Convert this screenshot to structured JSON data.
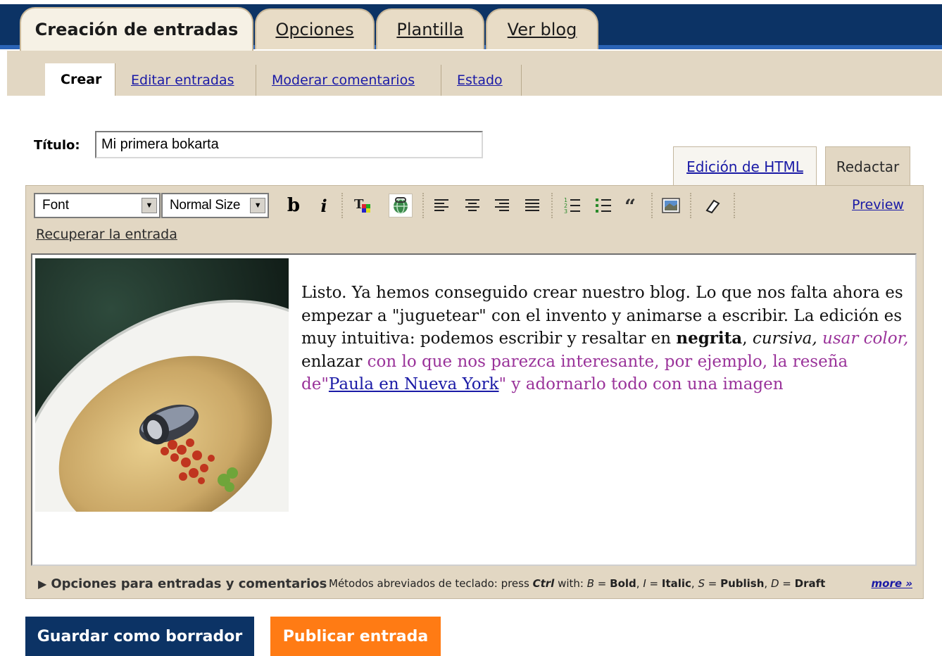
{
  "top_tabs": [
    {
      "label": "Creación de entradas",
      "active": true
    },
    {
      "label": "Opciones",
      "active": false
    },
    {
      "label": "Plantilla",
      "active": false
    },
    {
      "label": "Ver blog",
      "active": false
    }
  ],
  "sub_tabs": [
    {
      "label": "Crear",
      "active": true
    },
    {
      "label": "Editar entradas",
      "active": false
    },
    {
      "label": "Moderar comentarios",
      "active": false
    },
    {
      "label": "Estado",
      "active": false
    }
  ],
  "title_field": {
    "label": "Título:",
    "value": "Mi primera bokarta"
  },
  "mode_tabs": {
    "html": "Edición de HTML",
    "compose": "Redactar"
  },
  "toolbar": {
    "font_select": "Font",
    "size_select": "Normal Size",
    "bold": "b",
    "italic": "i",
    "preview": "Preview",
    "recover": "Recuperar la entrada",
    "icons": [
      "bold-icon",
      "italic-icon",
      "text-color-icon",
      "link-icon",
      "align-left-icon",
      "align-center-icon",
      "align-right-icon",
      "justify-icon",
      "numbered-list-icon",
      "bullet-list-icon",
      "blockquote-icon",
      "image-icon",
      "eraser-icon"
    ]
  },
  "post": {
    "p1": "Listo. Ya hemos conseguido crear nuestro blog. Lo que nos falta ahora es empezar a \"juguetear\" con el invento y animarse a escribir. La edición es muy intuitiva: podemos escribir y resaltar en ",
    "bold": "negrita",
    "comma": ",",
    "italic": "cursiva,",
    "colored": "usar color,",
    "plain2": "enlazar",
    "purple1": "con lo que nos parezca interesante, por ejemplo, la reseña de\"",
    "link": "Paula en Nueva York",
    "purple2": "\" y adornarlo todo con una imagen"
  },
  "footer": {
    "options": "Opciones para entradas y comentarios",
    "shortcuts_prefix": "Métodos abreviados de teclado: press",
    "ctrl": "Ctrl",
    "with": "with:",
    "sc_b_key": "B",
    "sc_b": "Bold",
    "sc_i_key": "I",
    "sc_i": "Italic",
    "sc_s_key": "S",
    "sc_s": "Publish",
    "sc_d_key": "D",
    "sc_d": "Draft",
    "more": "more »"
  },
  "buttons": {
    "draft": "Guardar como borrador",
    "publish": "Publicar entrada"
  },
  "colors": {
    "nav_blue": "#0c3365",
    "accent_orange": "#ff7b14",
    "panel_beige": "#e2d7c3",
    "text_purple": "#9a339a"
  }
}
